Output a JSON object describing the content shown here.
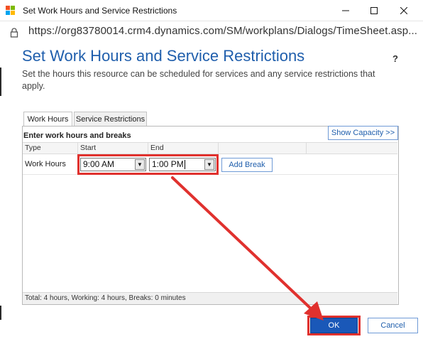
{
  "window": {
    "title": "Set Work Hours and Service Restrictions",
    "minimize_icon": "minimize-icon",
    "maximize_icon": "maximize-icon",
    "close_icon": "close-icon"
  },
  "address_bar": {
    "url": "https://org83780014.crm4.dynamics.com/SM/workplans/Dialogs/TimeSheet.asp..."
  },
  "dialog": {
    "title": "Set Work Hours and Service Restrictions",
    "help_label": "?",
    "description": "Set the hours this resource can be scheduled for services and any service restrictions that apply."
  },
  "tabs": [
    {
      "label": "Work Hours",
      "active": true
    },
    {
      "label": "Service Restrictions",
      "active": false
    }
  ],
  "grid": {
    "caption": "Enter work hours and breaks",
    "show_capacity_label": "Show Capacity >>",
    "columns": [
      "Type",
      "Start",
      "End"
    ],
    "row": {
      "type": "Work Hours",
      "start": "9:00 AM",
      "end": "1:00 PM",
      "add_break_label": "Add Break"
    },
    "footer": "Total: 4 hours, Working: 4 hours, Breaks: 0 minutes"
  },
  "buttons": {
    "ok": "OK",
    "cancel": "Cancel"
  },
  "colors": {
    "accent": "#1f5eac",
    "primary_button": "#1a58b8",
    "annotation": "#e0312e"
  }
}
